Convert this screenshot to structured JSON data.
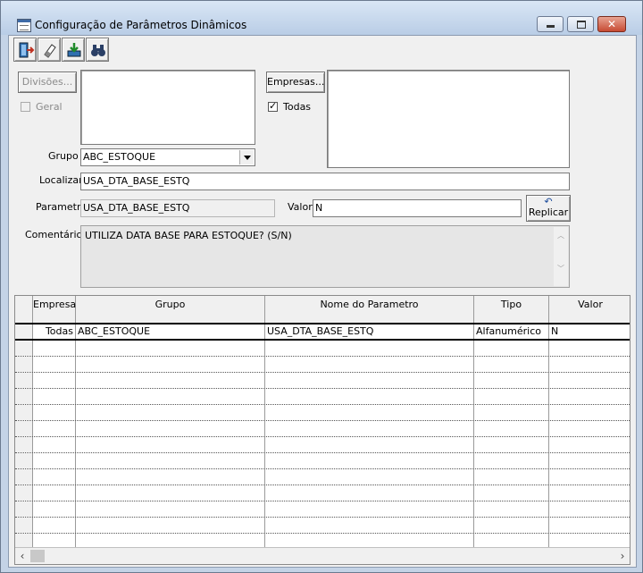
{
  "window": {
    "title": "Configuração de Parâmetros Dinâmicos"
  },
  "toolbar": {
    "buttons": [
      {
        "name": "exit-icon"
      },
      {
        "name": "eraser-icon"
      },
      {
        "name": "save-icon"
      },
      {
        "name": "binoculars-icon"
      }
    ]
  },
  "form": {
    "divisoes_button": "Divisões...",
    "geral_label": "Geral",
    "geral_checked": false,
    "empresas_button": "Empresas...",
    "todas_label": "Todas",
    "todas_checked": true,
    "grupo_label": "Grupo",
    "grupo_value": "ABC_ESTOQUE",
    "localizar_label": "Localizar",
    "localizar_value": "USA_DTA_BASE_ESTQ",
    "parametro_label": "Parametro",
    "parametro_value": "USA_DTA_BASE_ESTQ",
    "valor_label": "Valor",
    "valor_value": "N",
    "replicar_button": "Replicar",
    "comentarios_label": "Comentários",
    "comentarios_value": "UTILIZA DATA BASE PARA ESTOQUE? (S/N)"
  },
  "grid": {
    "columns": [
      "Empresa",
      "Grupo",
      "Nome do Parametro",
      "Tipo",
      "Valor"
    ],
    "rows": [
      [
        "Todas",
        "ABC_ESTOQUE",
        "USA_DTA_BASE_ESTQ",
        "Alfanumérico",
        "N"
      ]
    ],
    "empty_rows": 13
  },
  "colors": {
    "titlebar": "#c4d3e6",
    "close_button": "#c74a33"
  }
}
